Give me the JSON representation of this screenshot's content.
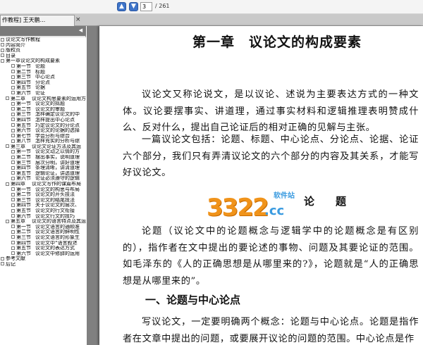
{
  "toolbar": {
    "up_label": "▲",
    "down_label": "▼",
    "page_value": "3",
    "page_total": "/ 261"
  },
  "tab": {
    "title": "作教程] 王天鹏...",
    "close": "×"
  },
  "sidebar": {
    "collapse": "◀",
    "items": [
      {
        "level": 0,
        "num": "",
        "label": "议论文写作教程"
      },
      {
        "level": 0,
        "num": "",
        "label": "内容简介"
      },
      {
        "level": 0,
        "num": "",
        "label": "版权页"
      },
      {
        "level": 0,
        "num": "",
        "label": "目录"
      },
      {
        "level": 0,
        "num": "第一章",
        "label": "议论文的构成要素"
      },
      {
        "level": 2,
        "num": "第一节",
        "label": "论题"
      },
      {
        "level": 2,
        "num": "第二节",
        "label": "标题"
      },
      {
        "level": 2,
        "num": "第三节",
        "label": "中心论点"
      },
      {
        "level": 2,
        "num": "第四节",
        "label": "分论点"
      },
      {
        "level": 2,
        "num": "第五节",
        "label": "论据"
      },
      {
        "level": 2,
        "num": "第六节",
        "label": "论证"
      },
      {
        "level": 1,
        "num": "第二章",
        "label": "议论文构思要素的运用方"
      },
      {
        "level": 2,
        "num": "第一节",
        "label": "议论文的拟题"
      },
      {
        "level": 2,
        "num": "第二节",
        "label": "议论文的审题"
      },
      {
        "level": 2,
        "num": "第三节",
        "label": "怎样确定议论文的中"
      },
      {
        "level": 2,
        "num": "第四节",
        "label": "怎样提出中心论点"
      },
      {
        "level": 2,
        "num": "第五节",
        "label": "巧定议论文的分论点"
      },
      {
        "level": 2,
        "num": "第六节",
        "label": "议论文的论据的选择"
      },
      {
        "level": 2,
        "num": "第七节",
        "label": "学会分析与综合"
      },
      {
        "level": 2,
        "num": "第八节",
        "label": "怎样充实的分析与综"
      },
      {
        "level": 1,
        "num": "第三章",
        "label": "议论文论证方法及其运"
      },
      {
        "level": 2,
        "num": "第一节",
        "label": "议论文动之以情的方"
      },
      {
        "level": 2,
        "num": "第二节",
        "label": "摆出事实，说明道理"
      },
      {
        "level": 2,
        "num": "第三节",
        "label": "层次分明，讲好道理"
      },
      {
        "level": 2,
        "num": "第四节",
        "label": "条理清晰，讲清道理"
      },
      {
        "level": 2,
        "num": "第五节",
        "label": "逻辑论证，讲透道理"
      },
      {
        "level": 2,
        "num": "第六节",
        "label": "论证必须遵守的逻辑"
      },
      {
        "level": 1,
        "num": "第四章",
        "label": "议论文写作的谋篇布局"
      },
      {
        "level": 2,
        "num": "第一节",
        "label": "议论文的构思与布局"
      },
      {
        "level": 2,
        "num": "第二节",
        "label": "议论文的开头技法"
      },
      {
        "level": 2,
        "num": "第三节",
        "label": "议论文的结尾技法"
      },
      {
        "level": 2,
        "num": "第四节",
        "label": "关于议论文的层次、"
      },
      {
        "level": 2,
        "num": "第五节",
        "label": "议论文的行文衔接"
      },
      {
        "level": 2,
        "num": "第六节",
        "label": "议论文行文的技巧"
      },
      {
        "level": 1,
        "num": "第五章",
        "label": "议论文的语言特点及其运"
      },
      {
        "level": 2,
        "num": "第一节",
        "label": "议论文语言的通顺准"
      },
      {
        "level": 2,
        "num": "第二节",
        "label": "议论文语言的鲜明性"
      },
      {
        "level": 2,
        "num": "第三节",
        "label": "议论文语言的形象生"
      },
      {
        "level": 2,
        "num": "第四节",
        "label": "议论文中“语言叙述"
      },
      {
        "level": 2,
        "num": "第五节",
        "label": "议论文的表达方式"
      },
      {
        "level": 2,
        "num": "第六节",
        "label": "议论文中修辞的运用"
      },
      {
        "level": 0,
        "num": "",
        "label": "参考文献"
      },
      {
        "level": 0,
        "num": "",
        "label": "后记"
      }
    ]
  },
  "document": {
    "chapter_title": "第一章　议论文的构成要素",
    "para1": "议论文又称论说文，是以议论、述说为主要表达方式的一种文体。议论要摆事实、讲道理，通过事实材料和逻辑推理表明赞成什么、反对什么，提出自己论证后的相对正确的见解与主张。",
    "para2": "一篇议论文包括：论题、标题、中心论点、分论点、论据、论证六个部分，我们只有弄清议论文的六个部分的内容及其关系，才能写好议论文。",
    "heading_lunti": "论　　题",
    "para3": "论题（议论文中的论题概念与逻辑学中的论题概念是有区别的），指作者在文中提出的要论述的事物、问题及其要论证的范围。如毛泽东的《人的正确思想是从哪里来的?》，论题就是“人的正确思想是从哪里来的”。",
    "heading_sec1": "一、论题与中心论点",
    "para4": "写议论文，一定要明确两个概念：论题与中心论点。论题是指作者在文章中提出的问题，或要展开议论的问题的范围。中心论点是作"
  },
  "watermark": {
    "digits": "3322",
    "cc": ".cc",
    "site": "软件站"
  }
}
